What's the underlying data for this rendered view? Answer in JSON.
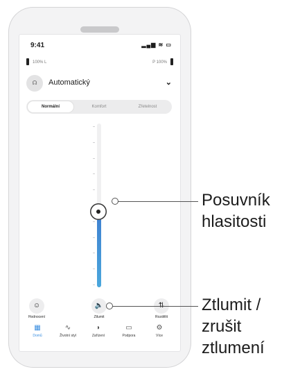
{
  "status": {
    "time": "9:41",
    "signal_icons": "▂▄▆ ≋ ▭"
  },
  "battery": {
    "left": "100% L",
    "right": "P 100%"
  },
  "program": {
    "icon": "☊",
    "name": "Automatický",
    "chevron": "⌄"
  },
  "modes": {
    "items": [
      "Normální",
      "Komfort",
      "Zřetelnost"
    ],
    "selected": 0
  },
  "volume": {
    "level": 0.46
  },
  "actions": {
    "rate": {
      "icon": "☺",
      "label": "Hodnocení"
    },
    "mute": {
      "icon": "🔈",
      "label": "Ztlumit"
    },
    "split": {
      "icon": "⇅",
      "label": "Rozdělit"
    }
  },
  "tabs": [
    {
      "icon": "▦",
      "label": "Domů",
      "active": true
    },
    {
      "icon": "∿",
      "label": "Životní styl",
      "active": false
    },
    {
      "icon": "◗",
      "label": "Zařízení",
      "active": false
    },
    {
      "icon": "▭",
      "label": "Podpora",
      "active": false
    },
    {
      "icon": "⚙",
      "label": "Více",
      "active": false
    }
  ],
  "callouts": {
    "volume": [
      "Posuvník",
      "hlasitosti"
    ],
    "mute": [
      "Ztlumit /",
      "zrušit",
      "ztlumení"
    ]
  }
}
